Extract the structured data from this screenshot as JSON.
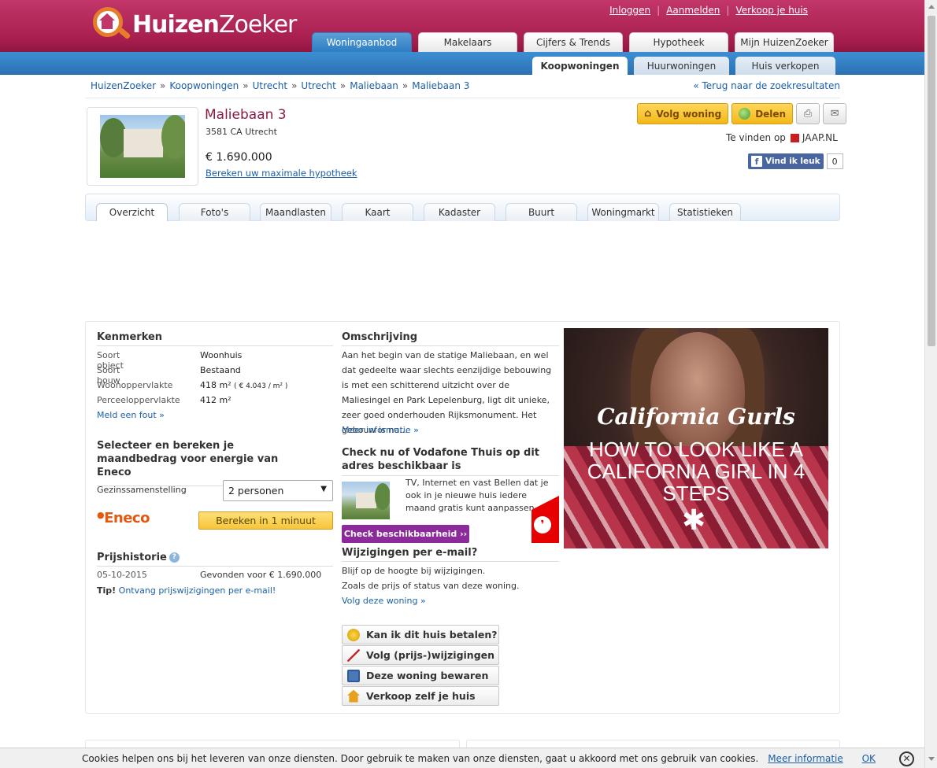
{
  "brand": {
    "logo_bold": "Huizen",
    "logo_light": "Zoeker"
  },
  "toplinks": {
    "login": "Inloggen",
    "register": "Aanmelden",
    "sell": "Verkoop je huis"
  },
  "main_tabs": [
    "Woningaanbod",
    "Makelaars",
    "Cijfers & Trends",
    "Hypotheek",
    "Mijn HuizenZoeker"
  ],
  "sub_tabs": [
    "Koopwoningen",
    "Huurwoningen",
    "Huis verkopen"
  ],
  "breadcrumb": [
    "HuizenZoeker",
    "»",
    "Koopwoningen",
    "»",
    "Utrecht",
    "»",
    "Utrecht",
    "»",
    "Maliebaan",
    "»",
    "Maliebaan 3"
  ],
  "back_link": "« Terug naar de zoekresultaten",
  "property": {
    "title": "Maliebaan 3",
    "address": "3581 CA Utrecht",
    "price": "€ 1.690.000",
    "mortgage_link": "Bereken uw maximale hypotheek"
  },
  "actions": {
    "follow": "Volg woning",
    "share": "Delen",
    "print_icon": "printer-icon",
    "mail_icon": "envelope-icon"
  },
  "found_on": {
    "label": "Te vinden op",
    "site": "JAAP.NL"
  },
  "facebook": {
    "label": "Vind ik leuk",
    "count": "0"
  },
  "detail_tabs": [
    "Overzicht",
    "Foto's",
    "Maandlasten",
    "Kaart",
    "Kadaster",
    "Buurt",
    "Woningmarkt",
    "Statistieken"
  ],
  "kenmerken": {
    "heading": "Kenmerken",
    "rows": [
      {
        "k": "Soort object",
        "v": "Woonhuis"
      },
      {
        "k": "Soort bouw",
        "v": "Bestaand"
      },
      {
        "k": "Woonoppervlakte",
        "v": "418 m²",
        "extra": "( € 4.043 / m² )"
      },
      {
        "k": "Perceeloppervlakte",
        "v": "412 m²"
      }
    ],
    "report_link": "Meld een fout »"
  },
  "energy": {
    "heading": "Selecteer en bereken je maandbedrag voor energie van Eneco",
    "household_label": "Gezinssamenstelling",
    "household_value": "2 personen",
    "brand": "Eneco",
    "button": "Bereken in 1 minuut"
  },
  "price_history": {
    "heading": "Prijshistorie",
    "date": "05-10-2015",
    "event": "Gevonden voor € 1.690.000",
    "tip_label": "Tip!",
    "tip_link": "Ontvang prijswijzigingen per e-mail!"
  },
  "description": {
    "heading": "Omschrijving",
    "text": "Aan het begin van de statige Maliebaan, en wel dat gedeelte waar slechts eenzijdige bebouwing is met een schitterend uitzicht over de Maliesingel en Park Lepelenburg, ligt dit unieke, zeer goed onderhouden Rijksmonument. Het gebouw is nu...",
    "more": "Meer informatie »"
  },
  "vodafone": {
    "heading": "Check nu of Vodafone Thuis op dit adres beschikbaar is",
    "text": "TV, Internet en vast Bellen dat je ook in je nieuwe huis iedere maand gratis kunt aanpassen",
    "button": "Check beschikbaarheid ››"
  },
  "email_updates": {
    "heading": "Wijzigingen per e-mail?",
    "line1": "Blijf op de hoogte bij wijzigingen.",
    "line2": "Zoals de prijs of status van deze woning.",
    "link": "Volg deze woning »"
  },
  "side_buttons": [
    "Kan ik dit huis betalen?",
    "Volg (prijs-)wijzigingen",
    "Deze woning bewaren",
    "Verkoop zelf je huis"
  ],
  "ad": {
    "script_title": "California Gurls",
    "headline": "HOW TO LOOK LIKE A CALIFORNIA GIRL IN 4 STEPS"
  },
  "cookie": {
    "text": "Cookies helpen ons bij het leveren van onze diensten. Door gebruik te maken van onze diensten, gaat u akkoord met ons gebruik van cookies.",
    "more": "Meer informatie",
    "ok": "OK"
  },
  "colors": {
    "brand_primary": "#a51d4d",
    "nav_blue": "#2e7dc3",
    "link": "#1a5fa8",
    "accent_yellow": "#f2b818",
    "vodafone_purple": "#8c2a9b"
  }
}
